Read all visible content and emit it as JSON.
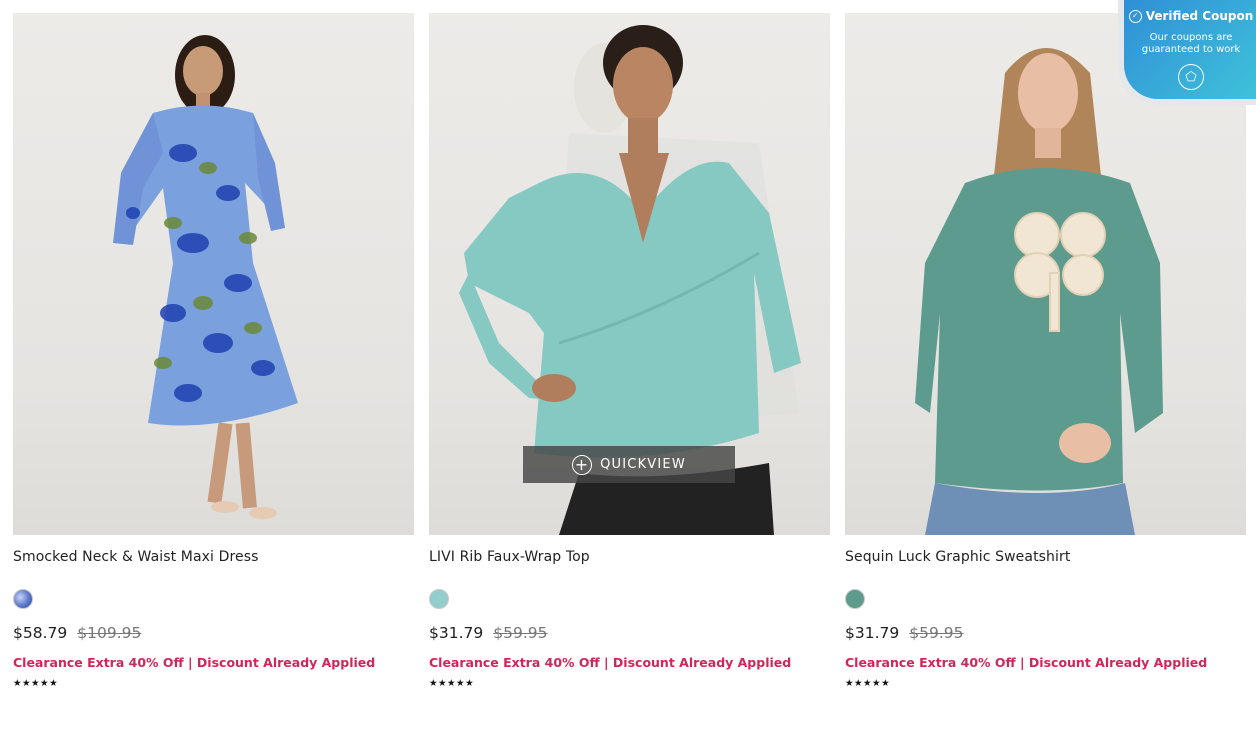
{
  "products": [
    {
      "name": "Smocked Neck & Waist Maxi Dress",
      "price_now": "$58.79",
      "price_was": "$109.95",
      "promo": "Clearance Extra 40% Off | Discount Already Applied",
      "stars": "★★★★★",
      "rating": 5,
      "swatch_color": "#5b78c8"
    },
    {
      "name": "LIVI Rib Faux-Wrap Top",
      "price_now": "$31.79",
      "price_was": "$59.95",
      "promo": "Clearance Extra 40% Off | Discount Already Applied",
      "stars": "★★★★★",
      "rating": 4.5,
      "swatch_color": "#93cdcc",
      "quickview_label": "QUICKVIEW"
    },
    {
      "name": "Sequin Luck Graphic Sweatshirt",
      "price_now": "$31.79",
      "price_was": "$59.95",
      "promo": "Clearance Extra 40% Off | Discount Already Applied",
      "stars": "★★★★★",
      "rating": 4.5,
      "swatch_color": "#5f9b8c"
    }
  ],
  "coupon_badge": {
    "title": "Verified Coupon",
    "subtitle": "Our coupons are guaranteed to work",
    "icon": "shield-icon"
  },
  "colors": {
    "promo": "#d22559",
    "badge_gradient_start": "#2f8fd6",
    "badge_gradient_end": "#3fc2da"
  }
}
